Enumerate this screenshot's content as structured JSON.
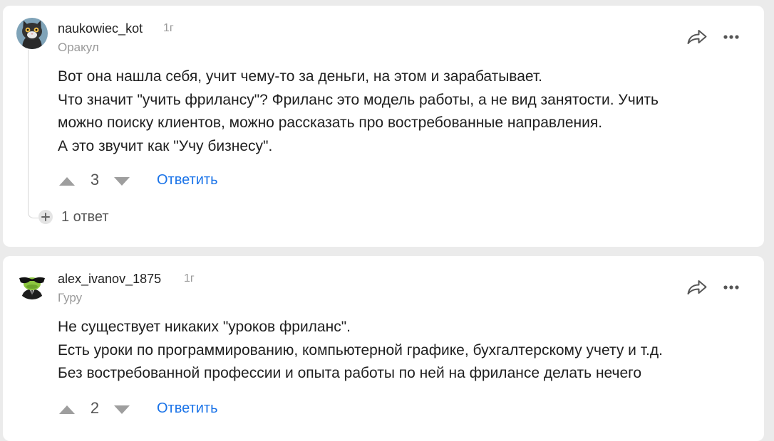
{
  "comments": [
    {
      "username": "naukowiec_kot",
      "time": "1г",
      "rank": "Оракул",
      "avatar_icon": "cat-avatar-icon",
      "lines": [
        "Вот она нашла себя, учит чему-то за деньги, на этом и зарабатывает.",
        "Что значит \"учить фрилансу\"? Фриланс это модель работы, а не вид занятости. Учить",
        "можно поиску клиентов, можно рассказать про востребованные направления.",
        "А это звучит как \"Учу бизнесу\"."
      ],
      "votes": "3",
      "reply_label": "Ответить",
      "replies_label": "1 ответ"
    },
    {
      "username": "alex_ivanov_1875",
      "time": "1г",
      "rank": "Гуру",
      "avatar_icon": "frog-avatar-icon",
      "lines": [
        "Не существует никаких \"уроков фриланс\".",
        "Есть уроки по программированию, компьютерной графике, бухгалтерскому учету и т.д.",
        "Без востребованной профессии и опыта работы по ней на фрилансе делать нечего"
      ],
      "votes": "2",
      "reply_label": "Ответить"
    }
  ],
  "icons": {
    "share": "share-arrow-icon",
    "more": "more-dots-icon",
    "upvote": "upvote-triangle-icon",
    "downvote": "downvote-triangle-icon",
    "expand": "plus-icon"
  },
  "colors": {
    "page_background": "#ebebeb",
    "card_background": "#ffffff",
    "link": "#1a73e8",
    "muted_text": "#9a9a9a"
  }
}
